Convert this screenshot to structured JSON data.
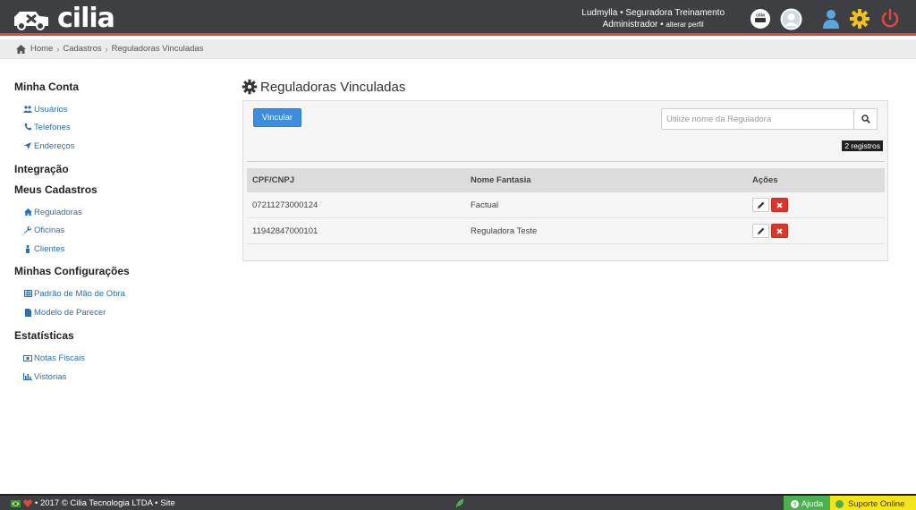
{
  "brand": {
    "name": "cilia"
  },
  "header": {
    "user_line": "Ludmylla • Seguradora Treinamento",
    "role": "Administrador",
    "role_sep": " • ",
    "change_profile": "alterar perfil",
    "company_badge": "cilia"
  },
  "breadcrumb": [
    "Home",
    "Cadastros",
    "Reguladoras Vinculadas"
  ],
  "sidebar": {
    "sections": [
      {
        "title": "Minha Conta",
        "items": [
          "Usuários",
          "Telefones",
          "Endereços"
        ]
      },
      {
        "title": "Integração",
        "items": []
      },
      {
        "title": "Meus Cadastros",
        "items": [
          "Reguladoras",
          "Oficinas",
          "Clientes"
        ]
      },
      {
        "title": "Minhas Configurações",
        "items": [
          "Padrão de Mão de Obra",
          "Modelo de Parecer"
        ]
      },
      {
        "title": "Estatísticas",
        "items": [
          "Notas Fiscais",
          "Vistorias"
        ]
      }
    ]
  },
  "main": {
    "title": "Reguladoras Vinculadas",
    "vincular_label": "Vincular",
    "search_placeholder": "Utilize nome da Reguladora",
    "records_badge": "2 registros",
    "columns": [
      "CPF/CNPJ",
      "Nome Fantasia",
      "Ações"
    ],
    "rows": [
      {
        "cnpj": "07211273000124",
        "nome": "Factual"
      },
      {
        "cnpj": "11942847000101",
        "nome": "Reguladora Teste"
      }
    ]
  },
  "footer": {
    "copyright": "• 2017 © Cilia Tecnologia LTDA •",
    "site": "Site",
    "ajuda": "Ajuda",
    "suporte": "Suporte Online"
  },
  "colors": {
    "topbar": "#3d3f43",
    "accent_red": "#e2473b",
    "primary_blue": "#3c8dde",
    "link_blue": "#2a6fb0",
    "delete_red": "#d9372b",
    "help_green": "#4caf50",
    "support_yellow": "#f4e51a"
  }
}
